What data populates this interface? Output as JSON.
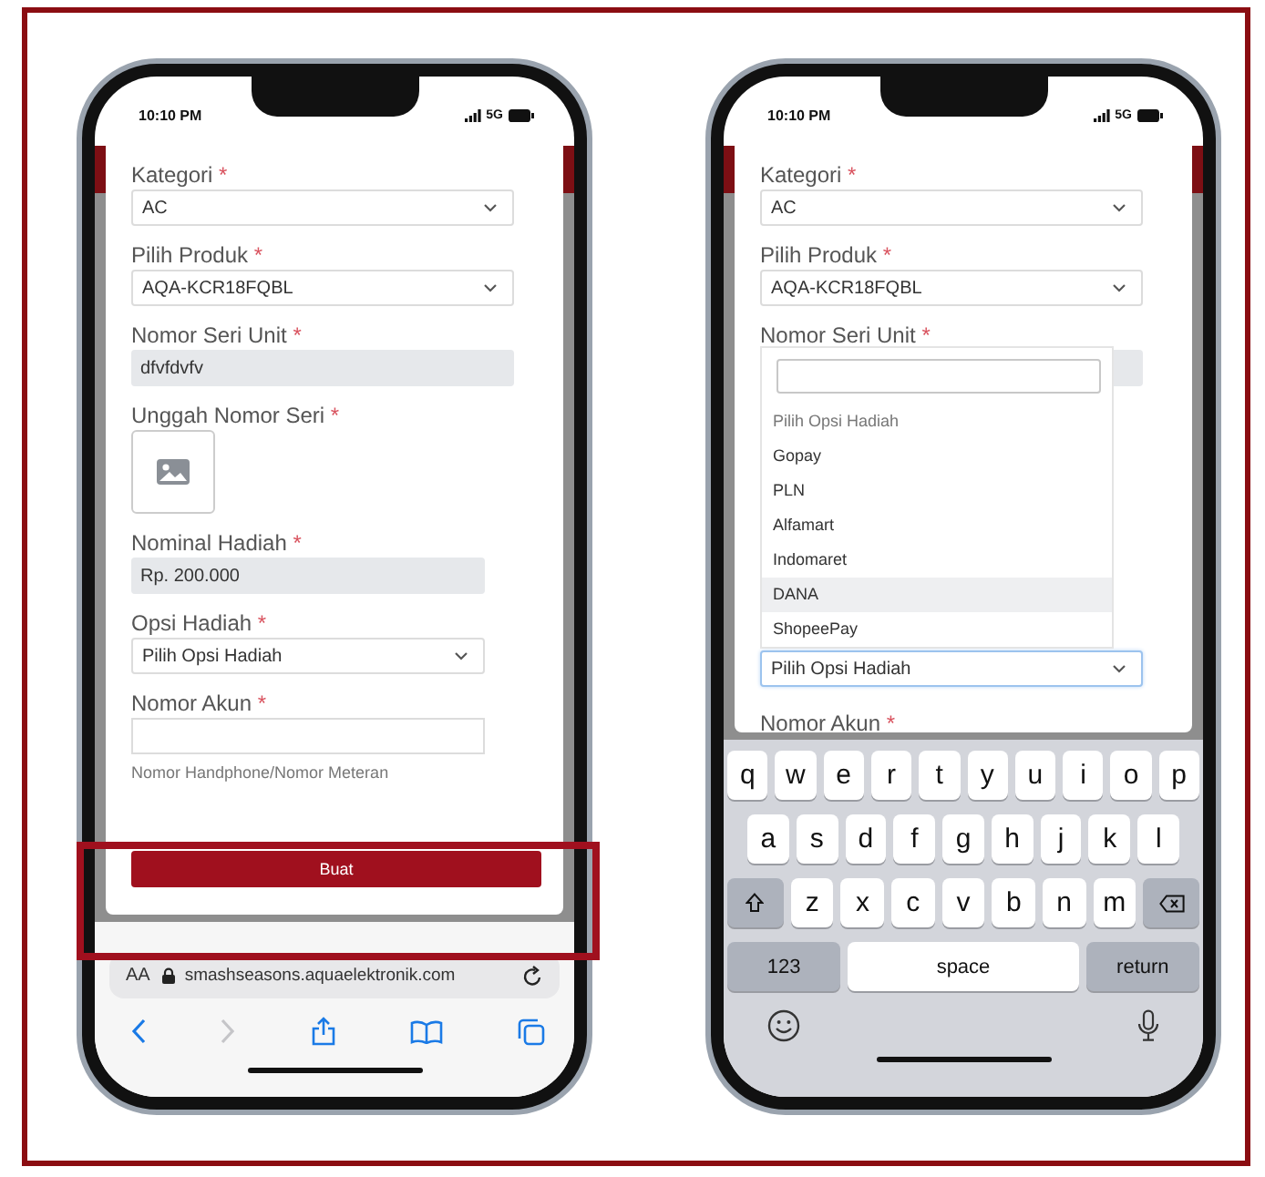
{
  "phones": [
    {
      "status_bar": {
        "time": "10:10 PM",
        "network": "5G"
      },
      "form": {
        "fields": [
          {
            "kind": "select",
            "label": "Kategori",
            "mark": "*",
            "value": "AC"
          },
          {
            "kind": "select",
            "label": "Pilih Produk",
            "mark": "*",
            "value": "AQA-KCR18FQBL"
          },
          {
            "kind": "readonly",
            "label": "Nomor Seri Unit",
            "mark": "*",
            "value": "dfvfdvfv"
          },
          {
            "kind": "upload",
            "label": "Unggah Nomor Seri",
            "mark": "*"
          },
          {
            "kind": "readonly",
            "label": "Nominal Hadiah",
            "mark": "*",
            "value": "Rp. 200.000"
          },
          {
            "kind": "select",
            "label": "Opsi Hadiah",
            "mark": "*",
            "value": "Pilih Opsi Hadiah",
            "focused": false
          },
          {
            "kind": "input",
            "label": "Nomor Akun",
            "mark": "*",
            "help": "Nomor Handphone/Nomor Meteran"
          }
        ],
        "submit": "Buat"
      },
      "highlighted_area": true,
      "browser_bar": {
        "text_size": "AA",
        "url": "smashseasons.aquaelektronik.com"
      }
    },
    {
      "status_bar": {
        "time": "10:10 PM",
        "network": "5G"
      },
      "form": {
        "fields": [
          {
            "kind": "select",
            "label": "Kategori",
            "mark": "*",
            "value": "AC"
          },
          {
            "kind": "select",
            "label": "Pilih Produk",
            "mark": "*",
            "value": "AQA-KCR18FQBL"
          },
          {
            "kind": "readonly",
            "label": "Nomor Seri Unit",
            "mark": "*"
          },
          {
            "kind": "select",
            "value": "Pilih Opsi Hadiah",
            "focused": true,
            "dropdown": {
              "options": [
                {
                  "kind": "placeholder",
                  "label": "Pilih Opsi Hadiah",
                  "highlighted": false
                },
                {
                  "kind": "option",
                  "label": "Gopay",
                  "highlighted": false
                },
                {
                  "kind": "option",
                  "label": "PLN",
                  "highlighted": false
                },
                {
                  "kind": "option",
                  "label": "Alfamart",
                  "highlighted": false
                },
                {
                  "kind": "option",
                  "label": "Indomaret",
                  "highlighted": false
                },
                {
                  "kind": "option",
                  "label": "DANA",
                  "highlighted": true
                },
                {
                  "kind": "option",
                  "label": "ShopeePay",
                  "highlighted": false
                }
              ]
            }
          },
          {
            "kind": "label",
            "label": "Nomor Akun",
            "mark": "*"
          }
        ]
      },
      "highlighted_area": false,
      "keyboard": {
        "rows": [
          {
            "keys": [
              {
                "kind": "char",
                "label": "q"
              },
              {
                "kind": "char",
                "label": "w"
              },
              {
                "kind": "char",
                "label": "e"
              },
              {
                "kind": "char",
                "label": "r"
              },
              {
                "kind": "char",
                "label": "t"
              },
              {
                "kind": "char",
                "label": "y"
              },
              {
                "kind": "char",
                "label": "u"
              },
              {
                "kind": "char",
                "label": "i"
              },
              {
                "kind": "char",
                "label": "o"
              },
              {
                "kind": "char",
                "label": "p"
              }
            ]
          },
          {
            "keys": [
              {
                "kind": "char",
                "label": "a"
              },
              {
                "kind": "char",
                "label": "s"
              },
              {
                "kind": "char",
                "label": "d"
              },
              {
                "kind": "char",
                "label": "f"
              },
              {
                "kind": "char",
                "label": "g"
              },
              {
                "kind": "char",
                "label": "h"
              },
              {
                "kind": "char",
                "label": "j"
              },
              {
                "kind": "char",
                "label": "k"
              },
              {
                "kind": "char",
                "label": "l"
              }
            ]
          },
          {
            "keys": [
              {
                "kind": "shift"
              },
              {
                "kind": "char",
                "label": "z"
              },
              {
                "kind": "char",
                "label": "x"
              },
              {
                "kind": "char",
                "label": "c"
              },
              {
                "kind": "char",
                "label": "v"
              },
              {
                "kind": "char",
                "label": "b"
              },
              {
                "kind": "char",
                "label": "n"
              },
              {
                "kind": "char",
                "label": "m"
              },
              {
                "kind": "backspace"
              }
            ]
          },
          {
            "keys": [
              {
                "kind": "mode",
                "label": "123"
              },
              {
                "kind": "space",
                "label": "space"
              },
              {
                "kind": "return",
                "label": "return"
              }
            ]
          },
          {
            "keys": [
              {
                "kind": "emoji"
              },
              {
                "kind": "mic"
              }
            ]
          }
        ]
      }
    }
  ]
}
